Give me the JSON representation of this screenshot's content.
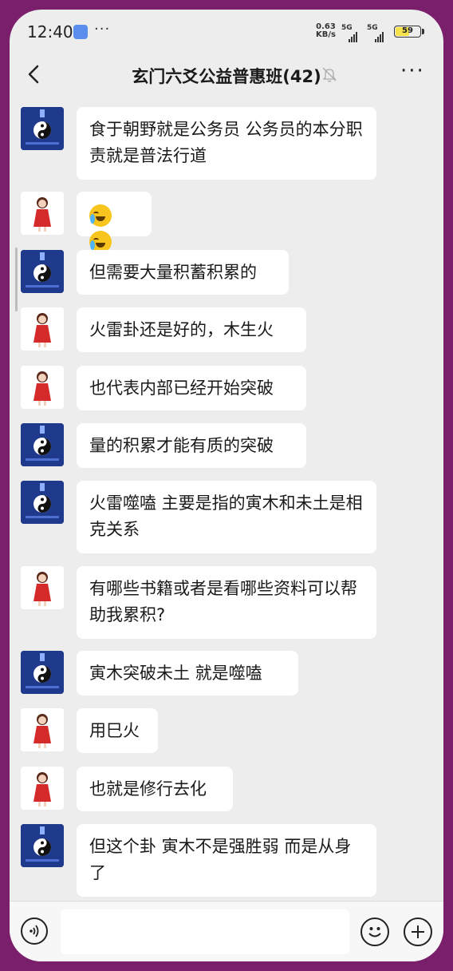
{
  "status_bar": {
    "time": "12:40",
    "more": "···",
    "net_speed_value": "0.63",
    "net_speed_unit": "KB/s",
    "signal1": "5G",
    "signal2": "5G",
    "battery": "59",
    "battery_level": 0.59
  },
  "header": {
    "title": "玄门六爻公益普惠班(42)",
    "more": "···"
  },
  "messages": [
    {
      "sender": "taiji",
      "text": "食于朝野就是公务员  公务员的本分职责就是普法行道"
    },
    {
      "sender": "girl",
      "emoji": [
        "crying-laugh-emoji",
        "crying-laugh-emoji"
      ]
    },
    {
      "sender": "taiji",
      "text": "但需要大量积蓄积累的"
    },
    {
      "sender": "girl",
      "text": "火雷卦还是好的，木生火"
    },
    {
      "sender": "girl",
      "text": "也代表内部已经开始突破"
    },
    {
      "sender": "taiji",
      "text": "量的积累才能有质的突破"
    },
    {
      "sender": "taiji",
      "text": "火雷噬嗑  主要是指的寅木和未土是相克关系"
    },
    {
      "sender": "girl",
      "text": "有哪些书籍或者是看哪些资料可以帮助我累积?"
    },
    {
      "sender": "taiji",
      "text": "寅木突破未土  就是噬嗑"
    },
    {
      "sender": "girl",
      "text": "用巳火"
    },
    {
      "sender": "girl",
      "text": "也就是修行去化"
    },
    {
      "sender": "taiji",
      "text": "但这个卦 寅木不是强胜弱  而是从身了"
    }
  ],
  "input_bar": {
    "placeholder": ""
  }
}
